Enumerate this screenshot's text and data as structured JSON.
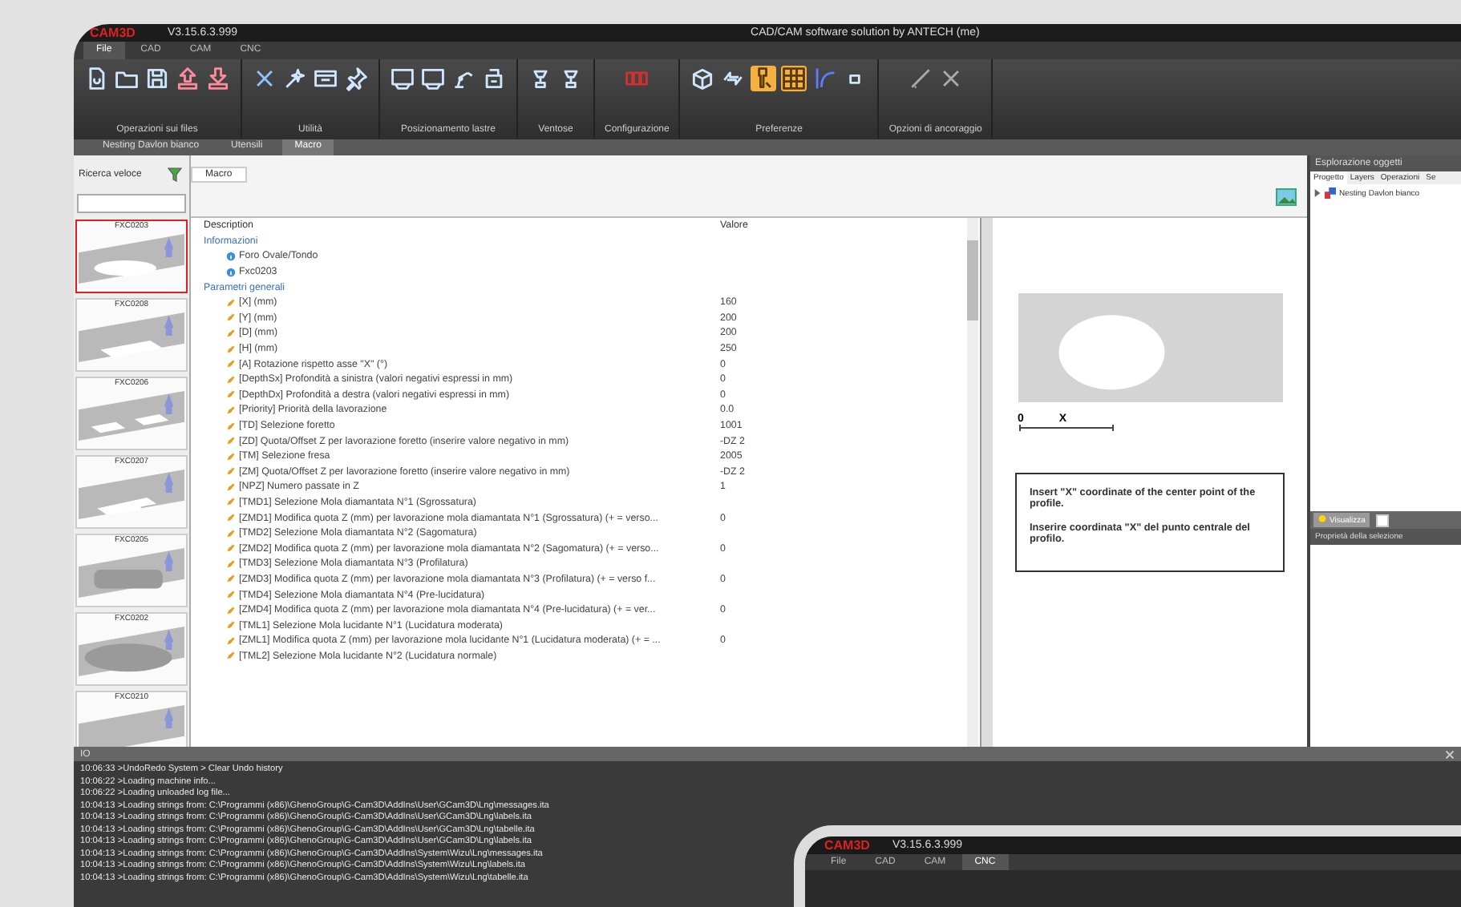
{
  "window": {
    "logo": "CAM3D",
    "version": "V3.15.6.3.999",
    "title": "CAD/CAM software solution by ANTECH (me)"
  },
  "menu": [
    {
      "label": "File",
      "selected": true
    },
    {
      "label": "CAD",
      "selected": false
    },
    {
      "label": "CAM",
      "selected": false
    },
    {
      "label": "CNC",
      "selected": false
    }
  ],
  "ribbon": [
    {
      "label": "Operazioni sui files",
      "tools": [
        {
          "kind": "file",
          "selected": false
        },
        {
          "kind": "folder",
          "selected": false
        },
        {
          "kind": "save",
          "selected": false
        },
        {
          "kind": "upload",
          "selected": false
        },
        {
          "kind": "download",
          "selected": false
        }
      ]
    },
    {
      "label": "Utilità",
      "tools": [
        {
          "kind": "delete",
          "selected": false
        },
        {
          "kind": "wand",
          "selected": false
        },
        {
          "kind": "window",
          "selected": false
        },
        {
          "kind": "pin",
          "selected": false
        }
      ]
    },
    {
      "label": "Posizionamento lastre",
      "tools": [
        {
          "kind": "sheet",
          "selected": false
        },
        {
          "kind": "sheet",
          "selected": false
        },
        {
          "kind": "robot",
          "selected": false
        },
        {
          "kind": "stack",
          "selected": false
        }
      ]
    },
    {
      "label": "Ventose",
      "tools": [
        {
          "kind": "suction",
          "selected": false
        },
        {
          "kind": "suction",
          "selected": false
        }
      ]
    },
    {
      "label": "Configurazione",
      "tools": [
        {
          "kind": "flag",
          "selected": false
        }
      ]
    },
    {
      "label": "Preferenze",
      "tools": [
        {
          "kind": "cube",
          "selected": false
        },
        {
          "kind": "arrows",
          "selected": false
        },
        {
          "kind": "tool",
          "selected": true
        },
        {
          "kind": "grid",
          "selected": true
        },
        {
          "kind": "curve",
          "selected": false
        },
        {
          "kind": "dot",
          "selected": false
        }
      ]
    },
    {
      "label": "Opzioni di ancoraggio",
      "tools": [
        {
          "kind": "line",
          "selected": false
        },
        {
          "kind": "cross",
          "selected": false
        }
      ]
    }
  ],
  "doc_tabs": [
    {
      "label": "Nesting Davlon bianco",
      "selected": false
    },
    {
      "label": "Utensili",
      "selected": false
    },
    {
      "label": "Macro",
      "selected": true
    }
  ],
  "library": {
    "search_label": "Ricerca veloce",
    "items": [
      {
        "code": "FXC0203",
        "kind": "oval-hole",
        "selected": true
      },
      {
        "code": "FXC0208",
        "kind": "rect-hole",
        "selected": false
      },
      {
        "code": "FXC0206",
        "kind": "two-holes",
        "selected": false
      },
      {
        "code": "FXC0207",
        "kind": "notch-hole",
        "selected": false
      },
      {
        "code": "FXC0205",
        "kind": "rounded-slab",
        "selected": false
      },
      {
        "code": "FXC0202",
        "kind": "oval-slab",
        "selected": false
      },
      {
        "code": "FXC0210",
        "kind": "slab",
        "selected": false
      }
    ]
  },
  "macro_tab": "Macro",
  "table": {
    "columns": [
      "Description",
      "Valore"
    ],
    "groups": [
      {
        "title": "Informazioni",
        "rows": [
          {
            "kind": "info",
            "label": "Foro Ovale/Tondo",
            "value": ""
          },
          {
            "kind": "info",
            "label": "Fxc0203",
            "value": ""
          }
        ]
      },
      {
        "title": "Parametri generali",
        "rows": [
          {
            "kind": "param",
            "label": "[X] (mm)",
            "value": "160"
          },
          {
            "kind": "param",
            "label": "[Y] (mm)",
            "value": "200"
          },
          {
            "kind": "param",
            "label": "[D] (mm)",
            "value": "200"
          },
          {
            "kind": "param",
            "label": "[H] (mm)",
            "value": "250"
          },
          {
            "kind": "param",
            "label": "[A] Rotazione rispetto asse \"X\" (°)",
            "value": "0"
          },
          {
            "kind": "param",
            "label": "[DepthSx] Profondità a sinistra (valori negativi espressi in mm)",
            "value": "0"
          },
          {
            "kind": "param",
            "label": "[DepthDx] Profondità a destra (valori negativi espressi in mm)",
            "value": "0"
          },
          {
            "kind": "param",
            "label": "[Priority] Priorità della lavorazione",
            "value": "0.0"
          },
          {
            "kind": "param",
            "label": "[TD] Selezione foretto",
            "value": "1001"
          },
          {
            "kind": "param",
            "label": "[ZD] Quota/Offset Z per lavorazione foretto (inserire valore negativo in mm)",
            "value": "-DZ 2"
          },
          {
            "kind": "param",
            "label": "[TM] Selezione fresa",
            "value": "2005"
          },
          {
            "kind": "param",
            "label": "[ZM] Quota/Offset Z per lavorazione foretto (inserire valore negativo in mm)",
            "value": "-DZ 2"
          },
          {
            "kind": "param",
            "label": "[NPZ] Numero passate in Z",
            "value": "1"
          },
          {
            "kind": "param",
            "label": "[TMD1] Selezione Mola diamantata N°1 (Sgrossatura)",
            "value": ""
          },
          {
            "kind": "param",
            "label": "[ZMD1] Modifica quota Z (mm) per lavorazione mola diamantata N°1 (Sgrossatura) (+ = verso...",
            "value": "0"
          },
          {
            "kind": "param",
            "label": "[TMD2] Selezione Mola diamantata N°2 (Sagomatura)",
            "value": ""
          },
          {
            "kind": "param",
            "label": "[ZMD2] Modifica quota Z (mm) per lavorazione mola diamantata N°2 (Sagomatura) (+ = verso...",
            "value": "0"
          },
          {
            "kind": "param",
            "label": "[TMD3] Selezione Mola diamantata N°3 (Profilatura)",
            "value": ""
          },
          {
            "kind": "param",
            "label": "[ZMD3] Modifica quota Z (mm) per lavorazione mola diamantata N°3 (Profilatura) (+ = verso f...",
            "value": "0"
          },
          {
            "kind": "param",
            "label": "[TMD4] Selezione Mola diamantata N°4 (Pre-lucidatura)",
            "value": ""
          },
          {
            "kind": "param",
            "label": "[ZMD4] Modifica quota Z (mm) per lavorazione mola diamantata N°4 (Pre-lucidatura) (+ = ver...",
            "value": "0"
          },
          {
            "kind": "param",
            "label": "[TML1] Selezione Mola lucidante N°1 (Lucidatura moderata)",
            "value": ""
          },
          {
            "kind": "param",
            "label": "[ZML1] Modifica quota Z (mm) per lavorazione mola lucidante N°1 (Lucidatura moderata) (+ = ...",
            "value": "0"
          },
          {
            "kind": "param",
            "label": "[TML2] Selezione Mola lucidante N°2 (Lucidatura normale)",
            "value": ""
          }
        ]
      }
    ]
  },
  "preview": {
    "origin": "0",
    "axis": "X",
    "help": [
      "Insert \"X\" coordinate of the center point of the profile.",
      "Inserire coordinata \"X\" del punto centrale del profilo."
    ]
  },
  "explorer": {
    "title": "Esplorazione oggetti",
    "tabs": [
      {
        "label": "Progetto",
        "selected": true
      },
      {
        "label": "Layers",
        "selected": false
      },
      {
        "label": "Operazioni",
        "selected": false
      },
      {
        "label": "Se",
        "selected": false
      }
    ],
    "tree": [
      {
        "label": "Nesting Davlon bianco",
        "expanded": false
      }
    ],
    "filter_label": "Visualizza",
    "filter_checked": false,
    "properties_title": "Proprietà della selezione"
  },
  "log": {
    "title": "IO",
    "lines": [
      "10:06:33 >UndoRedo System > Clear Undo history",
      "10:06:22 >Loading machine info...",
      "10:06:22 >Loading unloaded log file...",
      "10:04:13 >Loading strings from: C:\\Programmi (x86)\\GhenoGroup\\G-Cam3D\\AddIns\\User\\GCam3D\\Lng\\messages.ita",
      "10:04:13 >Loading strings from: C:\\Programmi (x86)\\GhenoGroup\\G-Cam3D\\AddIns\\User\\GCam3D\\Lng\\labels.ita",
      "10:04:13 >Loading strings from: C:\\Programmi (x86)\\GhenoGroup\\G-Cam3D\\AddIns\\User\\GCam3D\\Lng\\tabelle.ita",
      "10:04:13 >Loading strings from: C:\\Programmi (x86)\\GhenoGroup\\G-Cam3D\\AddIns\\User\\GCam3D\\Lng\\labels.ita",
      "10:04:13 >Loading strings from: C:\\Programmi (x86)\\GhenoGroup\\G-Cam3D\\AddIns\\System\\Wizu\\Lng\\messages.ita",
      "10:04:13 >Loading strings from: C:\\Programmi (x86)\\GhenoGroup\\G-Cam3D\\AddIns\\System\\Wizu\\Lng\\labels.ita",
      "10:04:13 >Loading strings from: C:\\Programmi (x86)\\GhenoGroup\\G-Cam3D\\AddIns\\System\\Wizu\\Lng\\tabelle.ita"
    ]
  },
  "second_window": {
    "logo": "CAM3D",
    "version": "V3.15.6.3.999",
    "menu": [
      {
        "label": "File",
        "selected": false
      },
      {
        "label": "CAD",
        "selected": false
      },
      {
        "label": "CAM",
        "selected": false
      },
      {
        "label": "CNC",
        "selected": true
      }
    ]
  }
}
